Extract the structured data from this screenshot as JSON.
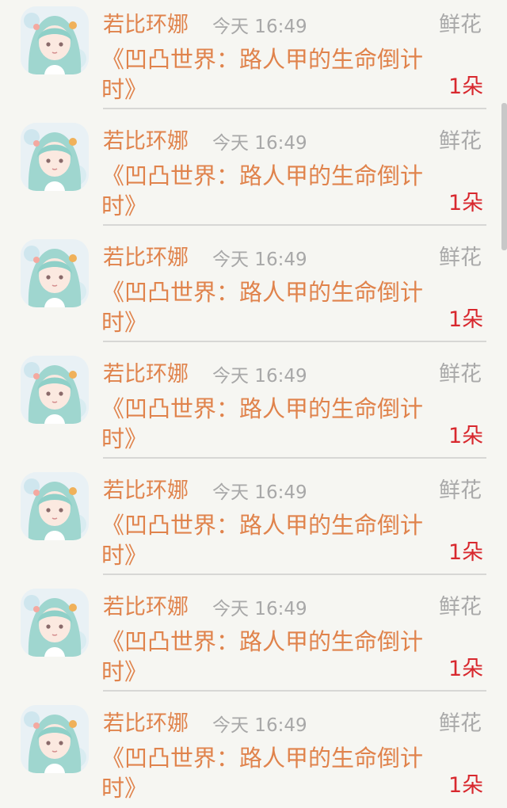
{
  "items": [
    {
      "name": "若比环娜",
      "time": "今天 16:49",
      "type": "鲜花",
      "book": "《凹凸世界：路人甲的生命倒计时》",
      "amount": "1朵"
    },
    {
      "name": "若比环娜",
      "time": "今天 16:49",
      "type": "鲜花",
      "book": "《凹凸世界：路人甲的生命倒计时》",
      "amount": "1朵"
    },
    {
      "name": "若比环娜",
      "time": "今天 16:49",
      "type": "鲜花",
      "book": "《凹凸世界：路人甲的生命倒计时》",
      "amount": "1朵"
    },
    {
      "name": "若比环娜",
      "time": "今天 16:49",
      "type": "鲜花",
      "book": "《凹凸世界：路人甲的生命倒计时》",
      "amount": "1朵"
    },
    {
      "name": "若比环娜",
      "time": "今天 16:49",
      "type": "鲜花",
      "book": "《凹凸世界：路人甲的生命倒计时》",
      "amount": "1朵"
    },
    {
      "name": "若比环娜",
      "time": "今天 16:49",
      "type": "鲜花",
      "book": "《凹凸世界：路人甲的生命倒计时》",
      "amount": "1朵"
    },
    {
      "name": "若比环娜",
      "time": "今天 16:49",
      "type": "鲜花",
      "book": "《凹凸世界：路人甲的生命倒计时》",
      "amount": "1朵"
    }
  ],
  "colors": {
    "name": "#e0834c",
    "book": "#e0834c",
    "time": "#a8a8a8",
    "type": "#a9a9a9",
    "amount": "#d8282e",
    "background": "#f6f6f2"
  },
  "avatar_icon": "anime-girl-avatar"
}
